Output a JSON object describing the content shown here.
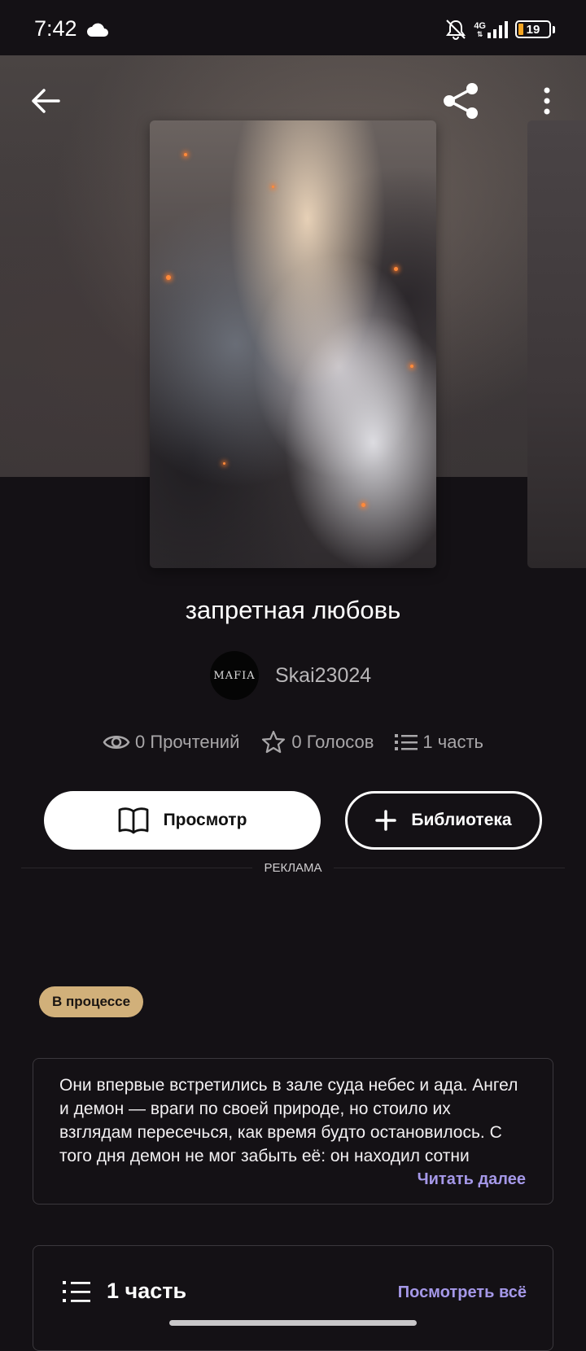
{
  "status_bar": {
    "time": "7:42",
    "battery": "19",
    "network": "4G"
  },
  "story": {
    "title": "запретная любовь",
    "author": {
      "name": "Skai23024",
      "avatar_text": "MAFIA"
    },
    "stats": {
      "reads": "0 Прочтений",
      "votes": "0 Голосов",
      "parts": "1 часть"
    },
    "status_badge": "В процессе",
    "description": "Они впервые встретились в зале суда небес и ада. Ангел и демон — враги по своей природе, но стоило их взглядам пересечься, как время будто остановилось. С того дня демон не мог забыть её: он находил сотни",
    "read_more": "Читать далее"
  },
  "actions": {
    "read_label": "Просмотр",
    "library_label": "Библиотека"
  },
  "ad_label": "РЕКЛАМА",
  "parts_section": {
    "title": "1 часть",
    "see_all": "Посмотреть всё"
  },
  "colors": {
    "background": "#141115",
    "accent": "#a598e8",
    "badge": "#d1b07a"
  }
}
